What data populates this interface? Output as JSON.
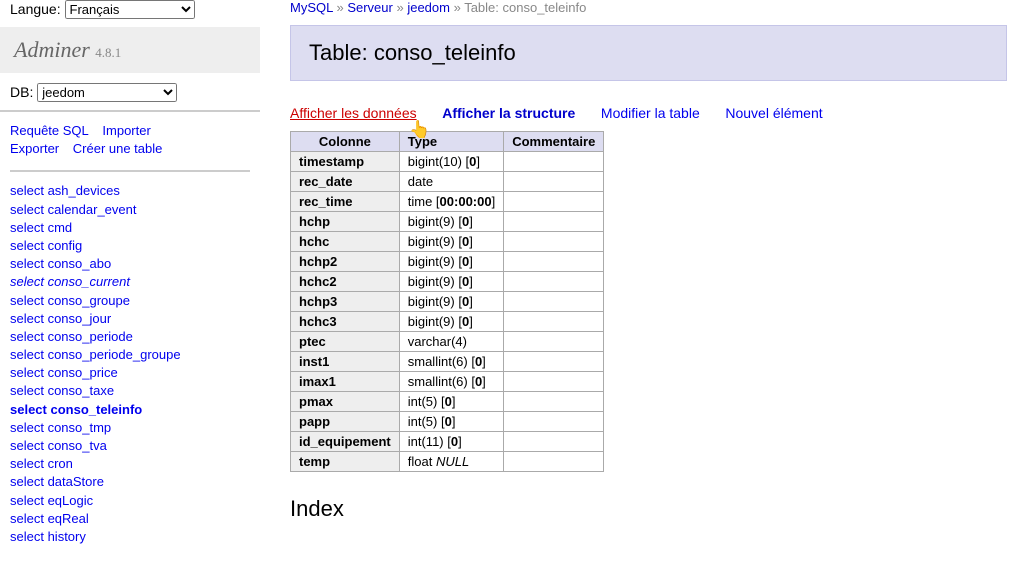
{
  "lang": {
    "label": "Langue:",
    "value": "Français"
  },
  "app": {
    "name": "Adminer",
    "version": "4.8.1"
  },
  "db": {
    "label": "DB:",
    "value": "jeedom"
  },
  "sideLinks": {
    "sql": "Requête SQL",
    "import": "Importer",
    "export": "Exporter",
    "create": "Créer une table"
  },
  "tables": [
    {
      "label": "select ash_devices"
    },
    {
      "label": "select calendar_event"
    },
    {
      "label": "select cmd"
    },
    {
      "label": "select config"
    },
    {
      "label": "select conso_abo"
    },
    {
      "label": "select conso_current",
      "italic": true
    },
    {
      "label": "select conso_groupe"
    },
    {
      "label": "select conso_jour"
    },
    {
      "label": "select conso_periode"
    },
    {
      "label": "select conso_periode_groupe"
    },
    {
      "label": "select conso_price"
    },
    {
      "label": "select conso_taxe"
    },
    {
      "label": "select conso_teleinfo",
      "bold": true
    },
    {
      "label": "select conso_tmp"
    },
    {
      "label": "select conso_tva"
    },
    {
      "label": "select cron"
    },
    {
      "label": "select dataStore"
    },
    {
      "label": "select eqLogic"
    },
    {
      "label": "select eqReal"
    },
    {
      "label": "select history"
    }
  ],
  "breadcrumbs": {
    "mysql": "MySQL",
    "server": "Serveur",
    "db": "jeedom",
    "tablePrefix": "Table:",
    "table": "conso_teleinfo"
  },
  "heading": "Table: conso_teleinfo",
  "tabs": {
    "data": "Afficher les données",
    "structure": "Afficher la structure",
    "alter": "Modifier la table",
    "new": "Nouvel élément"
  },
  "schema": {
    "headers": {
      "col": "Colonne",
      "type": "Type",
      "comment": "Commentaire"
    },
    "rows": [
      {
        "col": "timestamp",
        "type_a": "bigint(10) [",
        "type_b": "0",
        "type_c": "]"
      },
      {
        "col": "rec_date",
        "type_a": "date",
        "type_b": "",
        "type_c": ""
      },
      {
        "col": "rec_time",
        "type_a": "time [",
        "type_b": "00:00:00",
        "type_c": "]"
      },
      {
        "col": "hchp",
        "type_a": "bigint(9) [",
        "type_b": "0",
        "type_c": "]"
      },
      {
        "col": "hchc",
        "type_a": "bigint(9) [",
        "type_b": "0",
        "type_c": "]"
      },
      {
        "col": "hchp2",
        "type_a": "bigint(9) [",
        "type_b": "0",
        "type_c": "]"
      },
      {
        "col": "hchc2",
        "type_a": "bigint(9) [",
        "type_b": "0",
        "type_c": "]"
      },
      {
        "col": "hchp3",
        "type_a": "bigint(9) [",
        "type_b": "0",
        "type_c": "]"
      },
      {
        "col": "hchc3",
        "type_a": "bigint(9) [",
        "type_b": "0",
        "type_c": "]"
      },
      {
        "col": "ptec",
        "type_a": "varchar(4)",
        "type_b": "",
        "type_c": ""
      },
      {
        "col": "inst1",
        "type_a": "smallint(6) [",
        "type_b": "0",
        "type_c": "]"
      },
      {
        "col": "imax1",
        "type_a": "smallint(6) [",
        "type_b": "0",
        "type_c": "]"
      },
      {
        "col": "pmax",
        "type_a": "int(5) [",
        "type_b": "0",
        "type_c": "]"
      },
      {
        "col": "papp",
        "type_a": "int(5) [",
        "type_b": "0",
        "type_c": "]"
      },
      {
        "col": "id_equipement",
        "type_a": "int(11) [",
        "type_b": "0",
        "type_c": "]"
      },
      {
        "col": "temp",
        "type_a": "float ",
        "type_i": "NULL"
      }
    ]
  },
  "indexHeading": "Index"
}
